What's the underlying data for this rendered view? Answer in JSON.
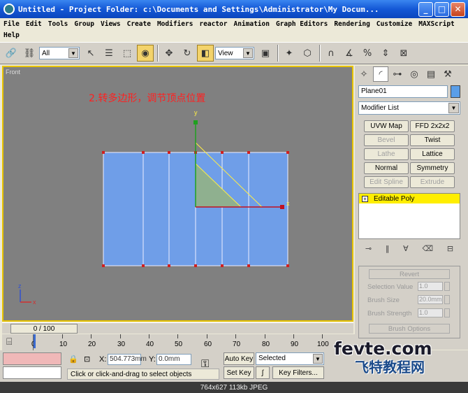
{
  "window": {
    "title": "Untitled      - Project Folder: c:\\Documents and Settings\\Administrator\\My Docum...",
    "minimize": "_",
    "maximize": "□",
    "close": "✕"
  },
  "menu": {
    "row1": [
      "File",
      "Edit",
      "Tools",
      "Group",
      "Views",
      "Create",
      "Modifiers",
      "reactor",
      "Animation",
      "Graph Editors",
      "Rendering",
      "Customize",
      "MAXScript"
    ],
    "row2": [
      "Help"
    ]
  },
  "toolbar": {
    "selection_filter": "All",
    "reference_coord": "View"
  },
  "viewport": {
    "label": "Front",
    "annotation": "2.转多边形，调节顶点位置",
    "axis_y": "y",
    "axis_x": "x",
    "gizmo_z": "z",
    "gizmo_x": "x",
    "colors": {
      "plane": "#6f9ee8",
      "background": "#808080",
      "border_active": "#e8c400",
      "selection": "#8fb08f"
    }
  },
  "command_panel": {
    "object_name": "Plane01",
    "modifier_list": "Modifier List",
    "buttons": [
      {
        "label": "UVW Map",
        "enabled": true
      },
      {
        "label": "FFD 2x2x2",
        "enabled": true
      },
      {
        "label": "Bevel",
        "enabled": false
      },
      {
        "label": "Twist",
        "enabled": true
      },
      {
        "label": "Lathe",
        "enabled": false
      },
      {
        "label": "Lattice",
        "enabled": true
      },
      {
        "label": "Normal",
        "enabled": true
      },
      {
        "label": "Symmetry",
        "enabled": true
      },
      {
        "label": "Edit Spline",
        "enabled": false
      },
      {
        "label": "Extrude",
        "enabled": false
      }
    ],
    "stack_item": "Editable Poly",
    "stack_expand": "+",
    "soft_selection": {
      "revert": "Revert",
      "selection_value_label": "Selection Value",
      "selection_value": "1.0",
      "brush_size_label": "Brush Size",
      "brush_size": "20.0mm",
      "brush_strength_label": "Brush Strength",
      "brush_strength": "1.0",
      "brush_options": "Brush Options"
    }
  },
  "timeline": {
    "frame_display": "0 / 100",
    "ticks": [
      "0",
      "10",
      "20",
      "30",
      "40",
      "50",
      "60",
      "70",
      "80",
      "90",
      "100"
    ]
  },
  "status": {
    "x_label": "X:",
    "x_value": "504.773mm",
    "y_label": "Y:",
    "y_value": "0.0mm",
    "auto_key": "Auto Key",
    "set_key": "Set Key",
    "selected": "Selected",
    "key_filters": "Key Filters...",
    "prompt": "Click or click-and-drag to select objects"
  },
  "caption": "764x627  113kb  JPEG",
  "watermark": {
    "line1": "fevte.com",
    "line2": "飞特教程网"
  }
}
